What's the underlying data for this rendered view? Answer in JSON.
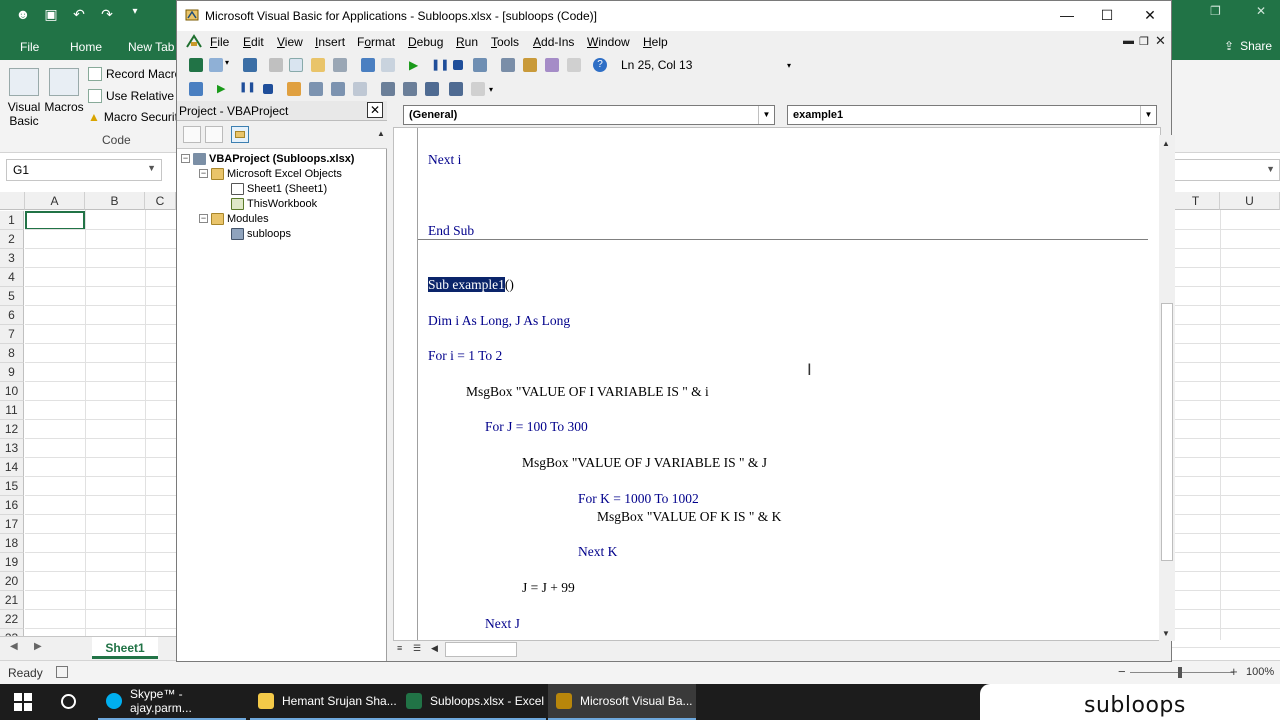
{
  "excel": {
    "ribbon_tabs": [
      "File",
      "Home",
      "New Tab"
    ],
    "share_label": "Share",
    "ribbon": {
      "visual_basic": "Visual Basic",
      "macros": "Macros",
      "record_macro": "Record Macro",
      "use_relative": "Use Relative R",
      "macro_security": "Macro Securit",
      "group_label": "Code"
    },
    "name_box": "G1",
    "columns_left": [
      "A",
      "B",
      "C"
    ],
    "columns_right": [
      "T",
      "U"
    ],
    "rows": [
      "1",
      "2",
      "3",
      "4",
      "5",
      "6",
      "7",
      "8",
      "9",
      "10",
      "11",
      "12",
      "13",
      "14",
      "15",
      "16",
      "17",
      "18",
      "19",
      "20",
      "21",
      "22",
      "23"
    ],
    "sheet_tab": "Sheet1",
    "status": "Ready",
    "zoom": "100%",
    "colors": {
      "excel_green": "#217346"
    }
  },
  "vbe": {
    "title": "Microsoft Visual Basic for Applications - Subloops.xlsx - [subloops (Code)]",
    "menus": [
      "File",
      "Edit",
      "View",
      "Insert",
      "Format",
      "Debug",
      "Run",
      "Tools",
      "Add-Ins",
      "Window",
      "Help"
    ],
    "menu_access_keys": [
      "F",
      "E",
      "V",
      "I",
      "o",
      "D",
      "R",
      "T",
      "A",
      "W",
      "H"
    ],
    "cursor_position": "Ln 25, Col 13",
    "project": {
      "title": "Project - VBAProject",
      "close": "✕",
      "tree": [
        {
          "label": "VBAProject (Subloops.xlsx)",
          "bold": true
        },
        {
          "label": "Microsoft Excel Objects"
        },
        {
          "label": "Sheet1 (Sheet1)"
        },
        {
          "label": "ThisWorkbook"
        },
        {
          "label": "Modules"
        },
        {
          "label": "subloops"
        }
      ]
    },
    "object_combo": "(General)",
    "procedure_combo": "example1",
    "code": {
      "next_i": "Next i",
      "end_sub": "End Sub",
      "sub_selected": "Sub example1",
      "sub_rest": "()",
      "dim_line": "Dim i As Long, J As Long",
      "for_i": "For i = 1 To 2",
      "msg_i": "MsgBox \"VALUE OF I VARIABLE IS \" & i",
      "for_j": "For J = 100 To 300",
      "msg_j": "MsgBox \"VALUE OF J VARIABLE IS \" & J",
      "for_k": "For K = 1000 To 1002",
      "msg_k": "MsgBox \"VALUE OF K IS \" & K",
      "next_k": "Next K",
      "j_inc": "J = J + 99",
      "next_j": "Next J"
    },
    "colors": {
      "keyword": "#00008b",
      "selection": "#0a246a"
    }
  },
  "taskbar": {
    "items": [
      {
        "label": "Skype™ - ajay.parm...",
        "icon": "skype-icon",
        "color": "#00aff0"
      },
      {
        "label": "Hemant Srujan Sha...",
        "icon": "folder-icon",
        "color": "#f3c948"
      },
      {
        "label": "Subloops.xlsx - Excel",
        "icon": "excel-icon",
        "color": "#217346"
      },
      {
        "label": "Microsoft Visual Ba...",
        "icon": "vba-icon",
        "color": "#b8860b"
      }
    ]
  },
  "overlay_label": "subloops"
}
